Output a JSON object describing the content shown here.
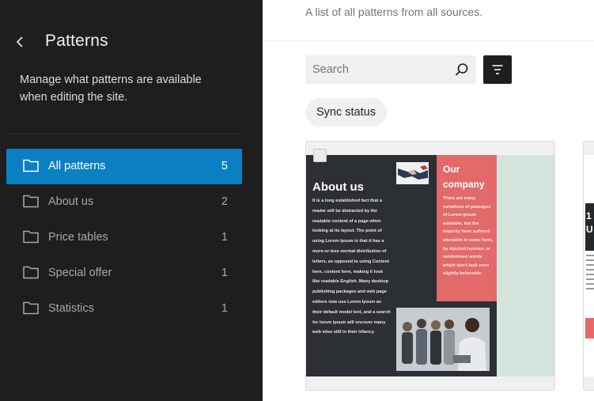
{
  "sidebar": {
    "title": "Patterns",
    "description": "Manage what patterns are available when editing the site.",
    "items": [
      {
        "label": "All patterns",
        "count": "5",
        "active": true
      },
      {
        "label": "About us",
        "count": "2",
        "active": false
      },
      {
        "label": "Price tables",
        "count": "1",
        "active": false
      },
      {
        "label": "Special offer",
        "count": "1",
        "active": false
      },
      {
        "label": "Statistics",
        "count": "1",
        "active": false
      }
    ]
  },
  "main": {
    "description": "A list of all patterns from all sources.",
    "search": {
      "placeholder": "Search",
      "value": ""
    },
    "sync_status_label": "Sync status",
    "card": {
      "about_title": "About us",
      "about_text": "It is a long established fact that a reader will be distracted by the readable content of a page when looking at its layout. The point of using Lorem Ipsum is that it has a more-or-less normal distribution of letters, as opposed to using Content here, content here, making it look like readable English. Many desktop publishing packages and web page editors now use Lorem Ipsum as their default model text, and a search for lorem ipsum will uncover many web sites still in their infancy.",
      "company_title": "Our company",
      "company_text": "There are many variations of passages of Lorem Ipsum available, but the majority have suffered alteration in some form, by injected humour, or randomised words which don't look even slightly believable."
    },
    "card2": {
      "number": "1",
      "letter": "U"
    }
  },
  "colors": {
    "sidebar_bg": "#1e1e1e",
    "accent": "#0a7fc2",
    "red_block": "#e26a6a",
    "dark_block": "#2c2f33",
    "mint_bg": "#d3e4dd"
  }
}
